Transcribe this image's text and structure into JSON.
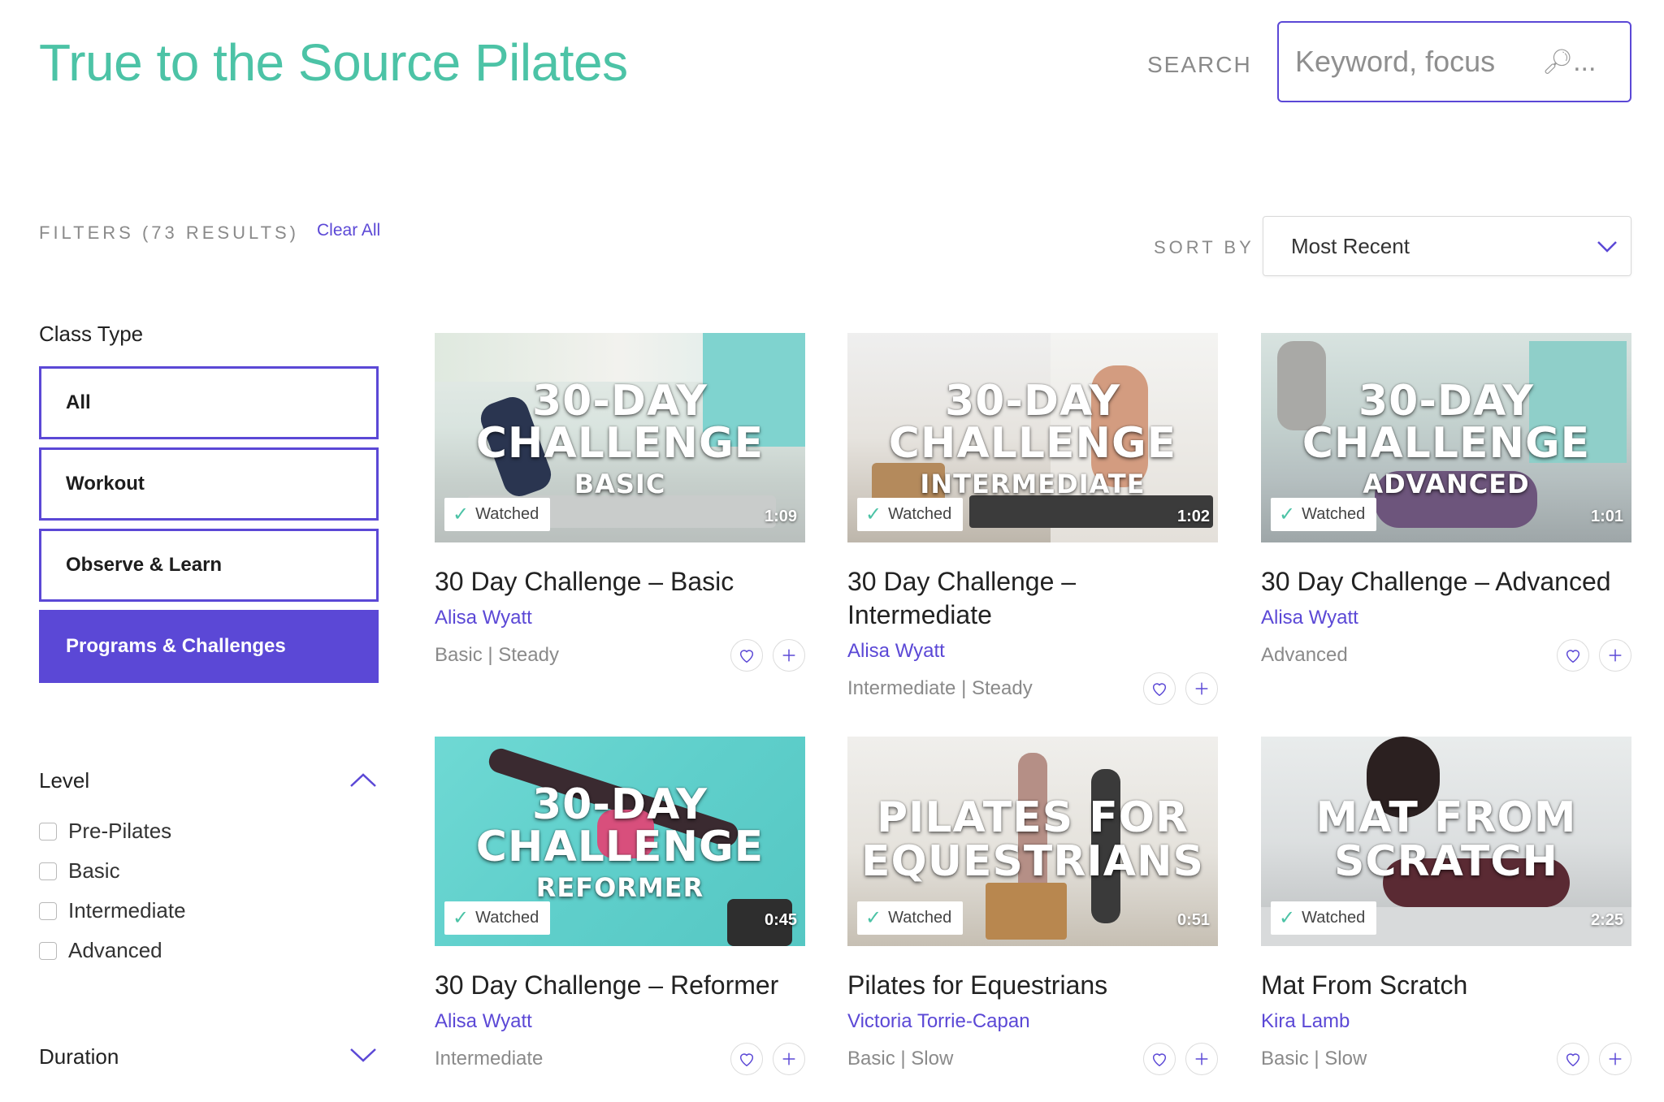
{
  "header": {
    "site_title": "True to the Source Pilates",
    "search_label": "SEARCH",
    "search_placeholder": "Keyword, focus",
    "search_ellipsis": "..."
  },
  "filters": {
    "label": "FILTERS (73 RESULTS)",
    "clear_all": "Clear All",
    "class_type": {
      "heading": "Class Type",
      "options": [
        "All",
        "Workout",
        "Observe & Learn",
        "Programs & Challenges"
      ],
      "selected": "Programs & Challenges"
    },
    "level": {
      "heading": "Level",
      "options": [
        "Pre-Pilates",
        "Basic",
        "Intermediate",
        "Advanced"
      ]
    },
    "duration": {
      "heading": "Duration"
    }
  },
  "sort": {
    "label": "SORT BY",
    "value": "Most Recent"
  },
  "cards": [
    {
      "thumb_line1": "30-DAY",
      "thumb_line2": "CHALLENGE",
      "thumb_line3": "BASIC",
      "watched": "Watched",
      "duration": "1:09",
      "title": "30 Day Challenge – Basic",
      "instructor": "Alisa Wyatt",
      "level": "Basic | Steady"
    },
    {
      "thumb_line1": "30-DAY",
      "thumb_line2": "CHALLENGE",
      "thumb_line3": "INTERMEDIATE",
      "watched": "Watched",
      "duration": "1:02",
      "title": "30 Day Challenge – Intermediate",
      "instructor": "Alisa Wyatt",
      "level": "Intermediate | Steady"
    },
    {
      "thumb_line1": "30-DAY",
      "thumb_line2": "CHALLENGE",
      "thumb_line3": "ADVANCED",
      "watched": "Watched",
      "duration": "1:01",
      "title": "30 Day Challenge – Advanced",
      "instructor": "Alisa Wyatt",
      "level": "Advanced"
    },
    {
      "thumb_line1": "30-DAY",
      "thumb_line2": "CHALLENGE",
      "thumb_line3": "REFORMER",
      "watched": "Watched",
      "duration": "0:45",
      "title": "30 Day Challenge – Reformer",
      "instructor": "Alisa Wyatt",
      "level": "Intermediate"
    },
    {
      "thumb_line1": "PILATES FOR",
      "thumb_line2": "EQUESTRIANS",
      "watched": "Watched",
      "duration": "0:51",
      "title": "Pilates for Equestrians",
      "instructor": "Victoria Torrie-Capan",
      "level": "Basic | Slow"
    },
    {
      "thumb_line1": "MAT FROM",
      "thumb_line2": "SCRATCH",
      "watched": "Watched",
      "duration": "2:25",
      "title": "Mat From Scratch",
      "instructor": "Kira Lamb",
      "level": "Basic | Slow"
    }
  ],
  "colors": {
    "brand_teal": "#4cc3a6",
    "accent_purple": "#5b48d6"
  }
}
